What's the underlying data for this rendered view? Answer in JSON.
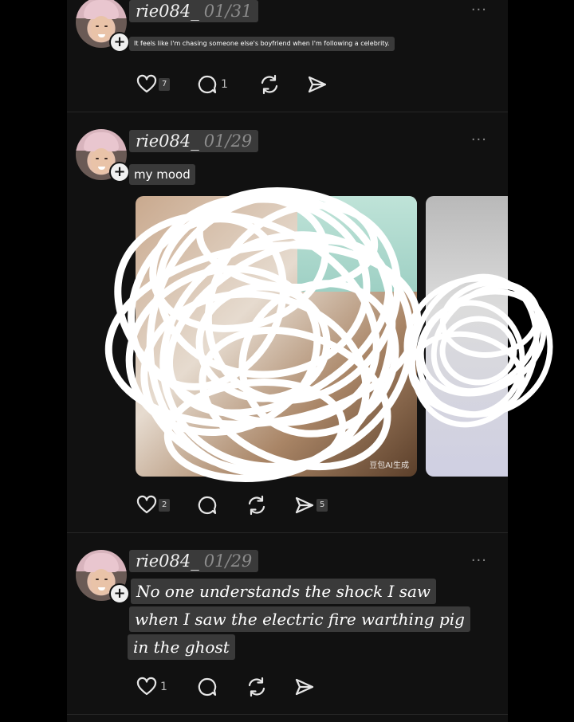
{
  "posts": [
    {
      "username": "rie084_",
      "date": "01/31",
      "caption": "It feels like I'm chasing someone else's boyfriend when I'm following a celebrity.",
      "likes": "7",
      "comments": "1",
      "reposts": "",
      "shares": ""
    },
    {
      "username": "rie084_",
      "date": "01/29",
      "caption": "my mood",
      "likes": "2",
      "comments": "",
      "reposts": "",
      "shares": "5",
      "image_watermark": "豆包AI生成"
    },
    {
      "username": "rie084_",
      "date": "01/29",
      "caption_lines": [
        "No one understands the shock I saw",
        "when I saw the electric fire warthing pig",
        "in the ghost"
      ],
      "likes": "1",
      "comments": "",
      "reposts": "",
      "shares": ""
    }
  ],
  "icons": {
    "more": "more-dots-icon",
    "like": "heart-icon",
    "comment": "comment-bubble-icon",
    "repost": "repost-icon",
    "share": "share-send-icon",
    "follow": "plus-icon"
  },
  "colors": {
    "background": "#000000",
    "feed": "#111111",
    "pill": "#3a3a3a",
    "icon": "#e6e6e6",
    "scribble": "#ffffff"
  },
  "more_label": "···",
  "follow_label": "+"
}
